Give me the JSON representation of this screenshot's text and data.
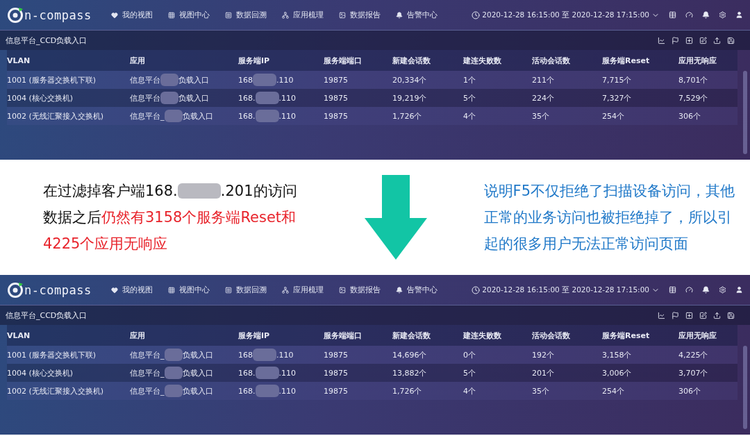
{
  "screens": [
    {
      "brand": "n-compass",
      "nav": [
        "我的视图",
        "视图中心",
        "数据回溯",
        "应用梳理",
        "数据报告",
        "告警中心"
      ],
      "time_range": "2020-12-28 16:15:00 至 2020-12-28 17:15:00",
      "panel_title": "信息平台_CCD负载入口",
      "columns": [
        "VLAN",
        "应用",
        "服务端IP",
        "服务端端口",
        "新建会话数",
        "建连失败数",
        "活动会话数",
        "服务端Reset",
        "应用无响应"
      ],
      "rows": [
        {
          "vlan": "1001 (服务器交换机下联)",
          "app_start": "信息平台",
          "app_end": "负载入口",
          "ip_start": "168",
          "ip_end": ".110",
          "port": "19875",
          "new": "20,334个",
          "fail": "1个",
          "active": "211个",
          "reset": "7,715个",
          "noresp": "8,701个"
        },
        {
          "vlan": "1004 (核心交换机)",
          "app_start": "信息平台",
          "app_end": "负载入口",
          "ip_start": "168.",
          "ip_end": ".110",
          "port": "19875",
          "new": "19,219个",
          "fail": "5个",
          "active": "224个",
          "reset": "7,327个",
          "noresp": "7,529个"
        },
        {
          "vlan": "1002 (无线汇聚接入交换机)",
          "app_start": "信息平台_",
          "app_end": "负载入口",
          "ip_start": "168.",
          "ip_end": ".110",
          "port": "19875",
          "new": "1,726个",
          "fail": "4个",
          "active": "35个",
          "reset": "254个",
          "noresp": "306个"
        }
      ]
    },
    {
      "brand": "n-compass",
      "nav": [
        "我的视图",
        "视图中心",
        "数据回溯",
        "应用梳理",
        "数据报告",
        "告警中心"
      ],
      "time_range": "2020-12-28 16:15:00 至 2020-12-28 17:15:00",
      "panel_title": "信息平台_CCD负载入口",
      "columns": [
        "VLAN",
        "应用",
        "服务端IP",
        "服务端端口",
        "新建会话数",
        "建连失败数",
        "活动会话数",
        "服务端Reset",
        "应用无响应"
      ],
      "rows": [
        {
          "vlan": "1001 (服务器交换机下联)",
          "app_start": "信息平台_",
          "app_end": "负载入口",
          "ip_start": "168",
          "ip_end": ".110",
          "port": "19875",
          "new": "14,696个",
          "fail": "0个",
          "active": "192个",
          "reset": "3,158个",
          "noresp": "4,225个"
        },
        {
          "vlan": "1004 (核心交换机)",
          "app_start": "信息平台_",
          "app_end": "负载入口",
          "ip_start": "168.",
          "ip_end": ".110",
          "port": "19875",
          "new": "13,882个",
          "fail": "5个",
          "active": "201个",
          "reset": "3,006个",
          "noresp": "3,707个"
        },
        {
          "vlan": "1002 (无线汇聚接入交换机)",
          "app_start": "信息平台_",
          "app_end": "负载入口",
          "ip_start": "168.",
          "ip_end": ".110",
          "port": "19875",
          "new": "1,726个",
          "fail": "4个",
          "active": "35个",
          "reset": "254个",
          "noresp": "306个"
        }
      ]
    }
  ],
  "note_left": [
    [
      {
        "kind": "plain",
        "text": "在过滤掉客户端168."
      },
      {
        "kind": "redacted"
      },
      {
        "kind": "plain",
        "text": ".201的访问"
      }
    ],
    [
      {
        "kind": "plain",
        "text": "数据之后"
      },
      {
        "kind": "emphasis",
        "text": "仍然有3158个服务端Reset和"
      }
    ],
    [
      {
        "kind": "emphasis",
        "text": "4225个应用无响应"
      }
    ]
  ],
  "note_right": [
    "说明F5不仅拒绝了扫描设备访问，其他",
    "正常的业务访问也被拒绝掉了，所以引",
    "起的很多用户无法正常访问页面"
  ]
}
